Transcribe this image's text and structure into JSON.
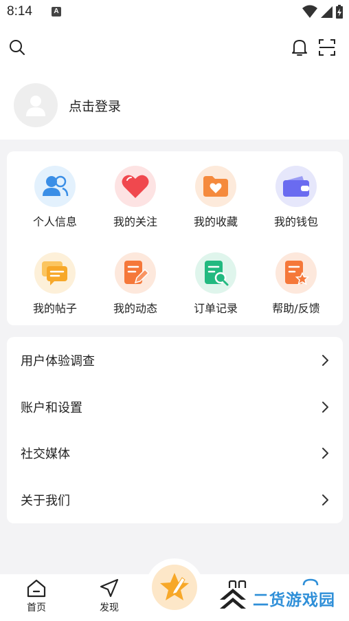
{
  "status_bar": {
    "time": "8:14",
    "notif_glyph": "A"
  },
  "profile": {
    "login_text": "点击登录"
  },
  "grid": [
    {
      "label": "个人信息",
      "icon": "user-group-icon",
      "bg": "#e3f1fd",
      "color": "#3a8ee6"
    },
    {
      "label": "我的关注",
      "icon": "heart-icon",
      "bg": "#fde3e3",
      "color": "#f0484e"
    },
    {
      "label": "我的收藏",
      "icon": "folder-heart-icon",
      "bg": "#fdeadb",
      "color": "#f58a3d"
    },
    {
      "label": "我的钱包",
      "icon": "wallet-icon",
      "bg": "#e6e7fb",
      "color": "#6a6bf0"
    },
    {
      "label": "我的帖子",
      "icon": "chat-icon",
      "bg": "#fdf0d9",
      "color": "#f7a829"
    },
    {
      "label": "我的动态",
      "icon": "edit-doc-icon",
      "bg": "#fde8dc",
      "color": "#f5783a"
    },
    {
      "label": "订单记录",
      "icon": "doc-search-icon",
      "bg": "#dff5ec",
      "color": "#22b980"
    },
    {
      "label": "帮助/反馈",
      "icon": "doc-star-icon",
      "bg": "#fde8dc",
      "color": "#f5783a"
    }
  ],
  "list": [
    {
      "label": "用户体验调查"
    },
    {
      "label": "账户和设置"
    },
    {
      "label": "社交媒体"
    },
    {
      "label": "关于我们"
    }
  ],
  "nav": {
    "home": "首页",
    "discover": "发现"
  },
  "watermark": "二货游戏园"
}
